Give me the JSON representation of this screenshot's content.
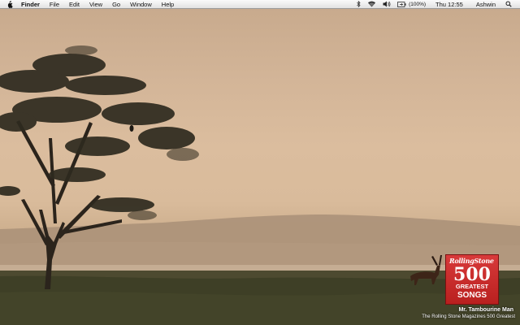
{
  "menubar": {
    "apple_icon": "apple-logo-icon",
    "app_name": "Finder",
    "menus": [
      "File",
      "Edit",
      "View",
      "Go",
      "Window",
      "Help"
    ],
    "status": {
      "bluetooth_icon": "bluetooth-icon",
      "wifi_icon": "wifi-icon",
      "volume_icon": "volume-icon",
      "battery_icon": "battery-icon",
      "battery_text": "(100%)",
      "clock": "Thu 12:55",
      "user": "Ashwin",
      "spotlight_icon": "magnifier-icon"
    }
  },
  "now_playing": {
    "album_art": {
      "brand": "RollingStone",
      "number": "500",
      "line1": "GREATEST",
      "line2": "SONGS"
    },
    "track_title": "Mr. Tambourine Man",
    "album_title": "The Rolling Stone Magazines 500 Greatest"
  },
  "colors": {
    "sky_top": "#c7a98c",
    "sky_horizon": "#dbbd9e",
    "hill": "#a89078",
    "ground": "#4b4a2f",
    "album_red": "#c8292a"
  }
}
